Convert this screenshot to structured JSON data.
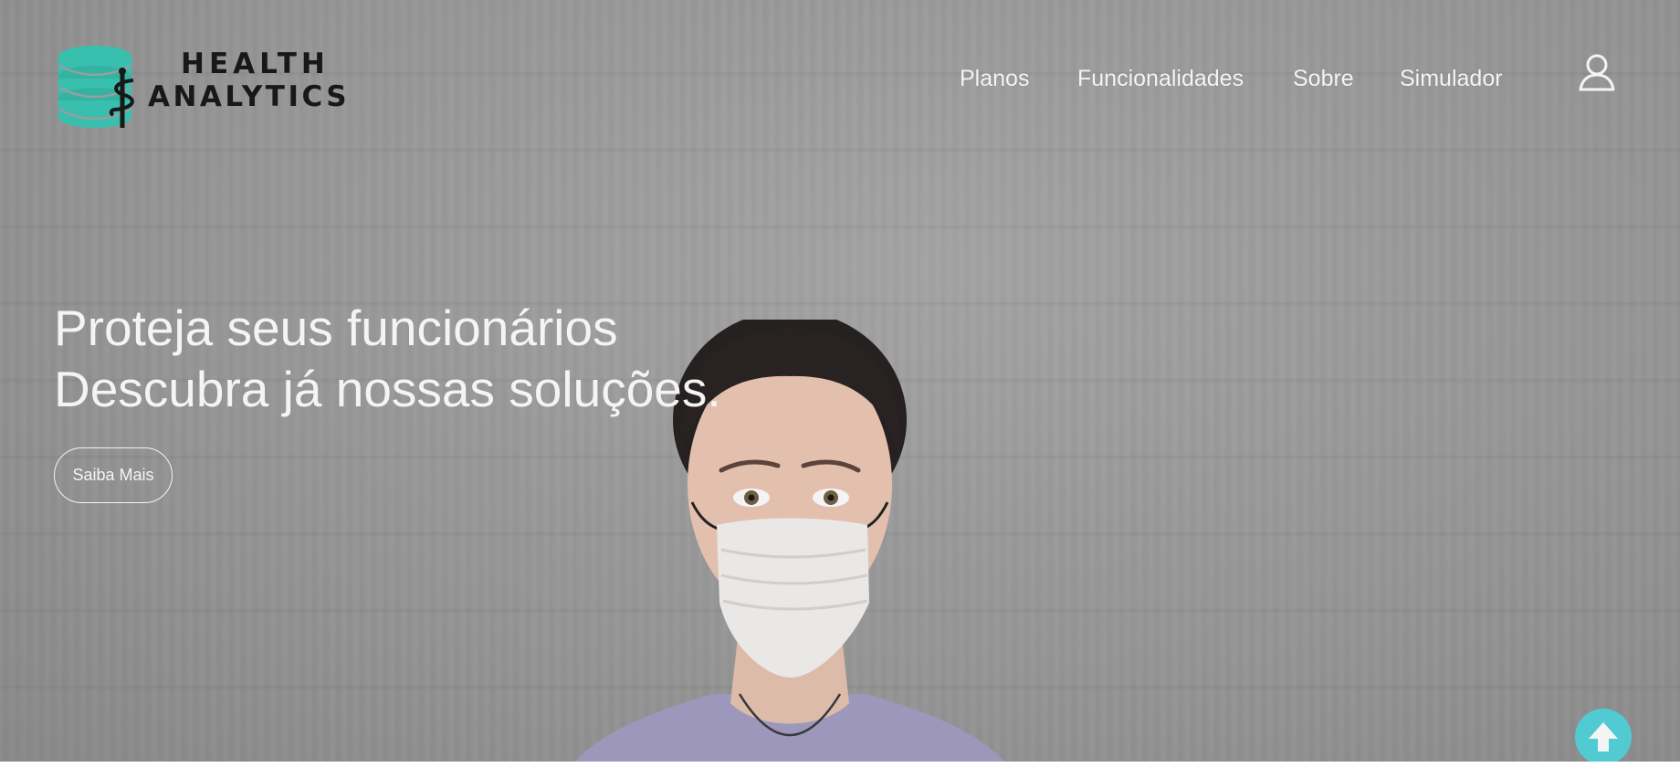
{
  "brand": {
    "line1": "HEALTH",
    "line2": "ANALYTICS",
    "icon": "database-caduceus-logo",
    "accent_color": "#3cc8b4"
  },
  "nav": {
    "items": [
      {
        "label": "Planos"
      },
      {
        "label": "Funcionalidades"
      },
      {
        "label": "Sobre"
      },
      {
        "label": "Simulador"
      }
    ],
    "user_icon": "user-icon"
  },
  "hero": {
    "headline_line1": "Proteja seus funcionários",
    "headline_line2": "Descubra já nossas soluções.",
    "cta_label": "Saiba Mais"
  },
  "scroll_top": {
    "icon": "arrow-up-icon",
    "color": "#4fd3d9"
  }
}
